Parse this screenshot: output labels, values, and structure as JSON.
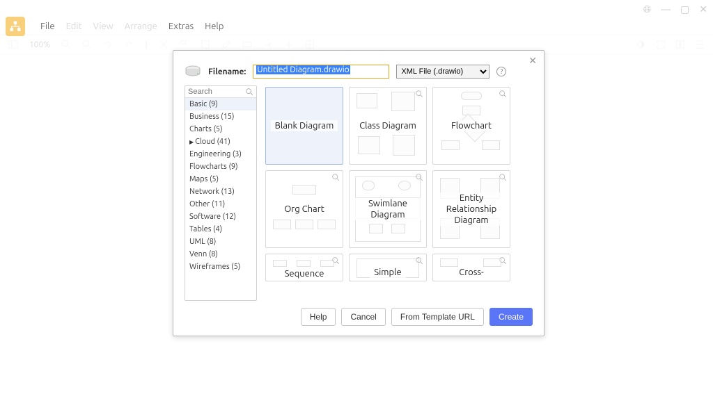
{
  "menubar": {
    "items": [
      "File",
      "Edit",
      "View",
      "Arrange",
      "Extras",
      "Help"
    ]
  },
  "toolbar": {
    "zoom": "100%"
  },
  "dialog": {
    "filename_label": "Filename:",
    "filename_value": "Untitled Diagram.drawio",
    "filetype_label": "XML File (.drawio)",
    "search_placeholder": "Search",
    "categories": [
      {
        "label": "Basic (9)",
        "selected": true
      },
      {
        "label": "Business (15)"
      },
      {
        "label": "Charts (5)"
      },
      {
        "label": "Cloud (41)",
        "expandable": true
      },
      {
        "label": "Engineering (3)"
      },
      {
        "label": "Flowcharts (9)"
      },
      {
        "label": "Maps (5)"
      },
      {
        "label": "Network (13)"
      },
      {
        "label": "Other (11)"
      },
      {
        "label": "Software (12)"
      },
      {
        "label": "Tables (4)"
      },
      {
        "label": "UML (8)"
      },
      {
        "label": "Venn (8)"
      },
      {
        "label": "Wireframes (5)"
      }
    ],
    "templates": [
      {
        "label": "Blank Diagram",
        "selected": true
      },
      {
        "label": "Class Diagram"
      },
      {
        "label": "Flowchart"
      },
      {
        "label": "Org Chart"
      },
      {
        "label": "Swimlane Diagram"
      },
      {
        "label": "Entity Relationship Diagram"
      },
      {
        "label": "Sequence"
      },
      {
        "label": "Simple"
      },
      {
        "label": "Cross-"
      }
    ],
    "buttons": {
      "help": "Help",
      "cancel": "Cancel",
      "from_url": "From Template URL",
      "create": "Create"
    }
  }
}
